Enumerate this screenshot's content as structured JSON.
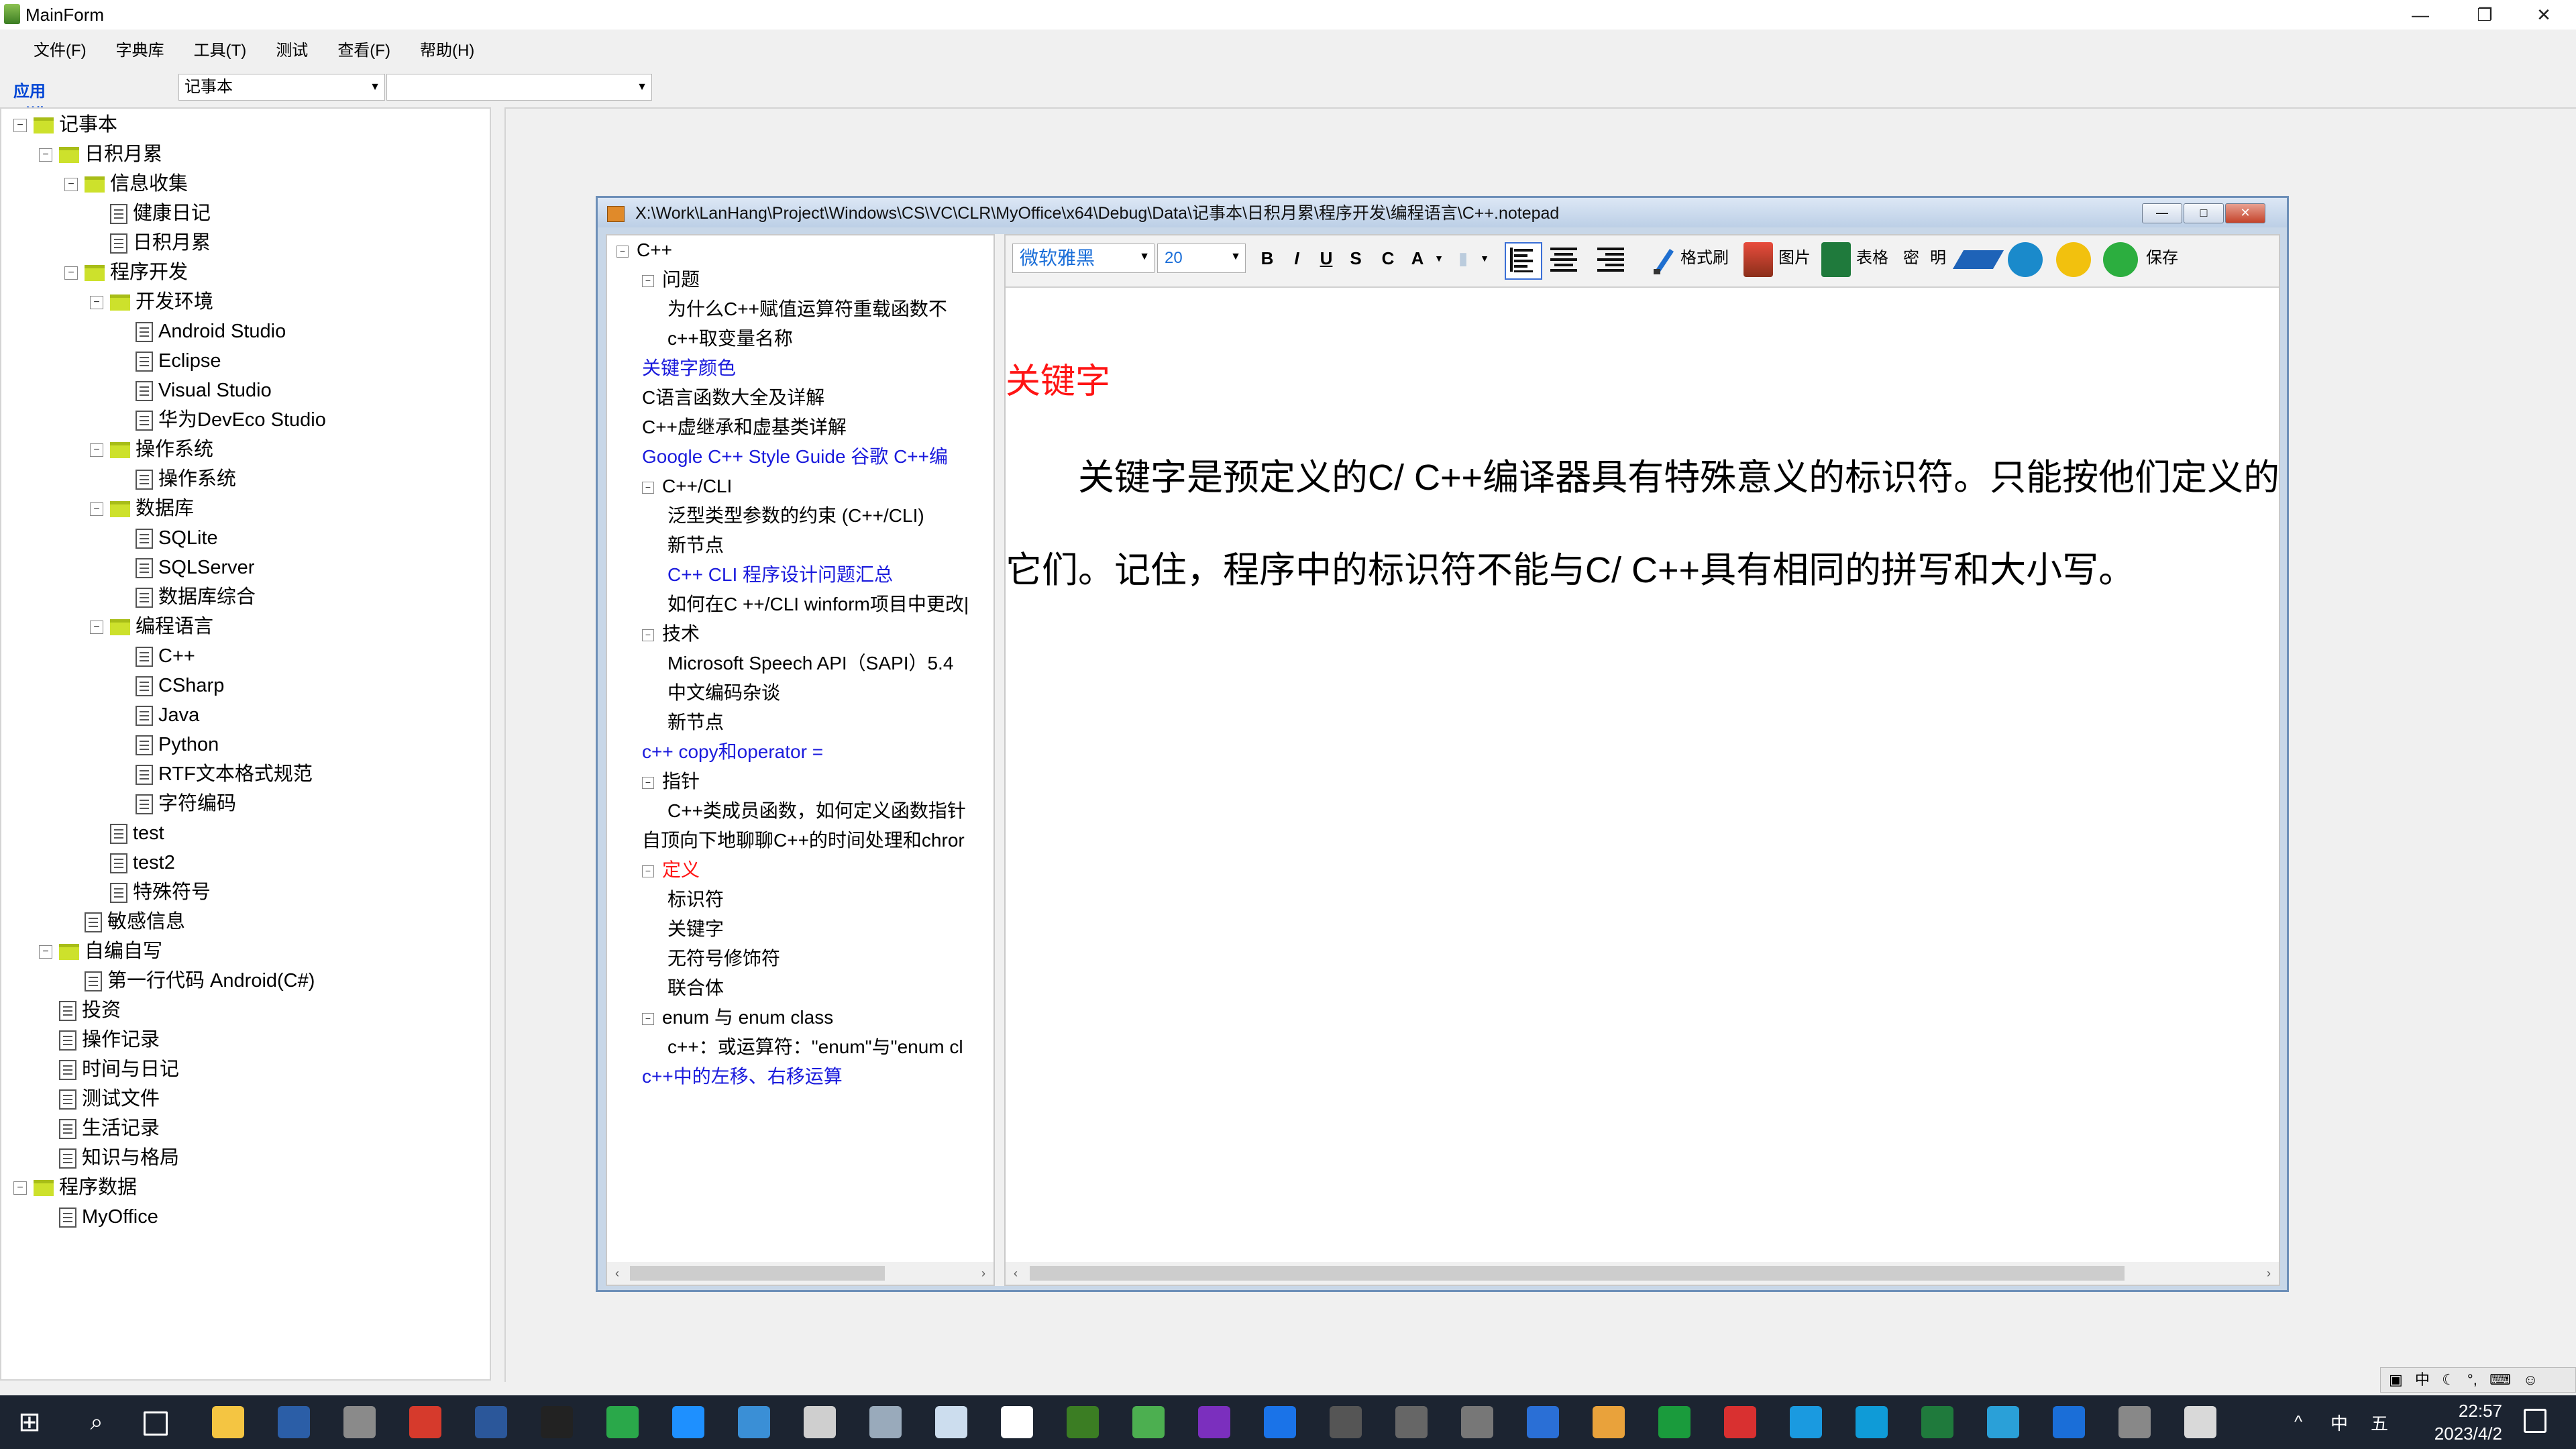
{
  "window": {
    "title": "MainForm",
    "minimize": "—",
    "restore": "❐",
    "close": "✕"
  },
  "menu": [
    {
      "label": "文件(F)"
    },
    {
      "label": "字典库"
    },
    {
      "label": "工具(T)"
    },
    {
      "label": "测试"
    },
    {
      "label": "查看(F)"
    },
    {
      "label": "帮助(H)"
    }
  ],
  "module_bar": {
    "label": "应用（模块）类型:",
    "selected": "记事本",
    "second": ""
  },
  "tree": [
    {
      "label": "记事本",
      "icon": "folder",
      "exp": "−"
    },
    {
      "label": "日积月累",
      "icon": "folder",
      "exp": "−"
    },
    {
      "label": "信息收集",
      "icon": "folder",
      "exp": "−"
    },
    {
      "label": "健康日记",
      "icon": "doc"
    },
    {
      "label": "日积月累",
      "icon": "doc"
    },
    {
      "label": "程序开发",
      "icon": "folder",
      "exp": "−"
    },
    {
      "label": "开发环境",
      "icon": "folder",
      "exp": "−"
    },
    {
      "label": "Android Studio",
      "icon": "doc"
    },
    {
      "label": "Eclipse",
      "icon": "doc"
    },
    {
      "label": "Visual Studio",
      "icon": "doc"
    },
    {
      "label": "华为DevEco Studio",
      "icon": "doc"
    },
    {
      "label": "操作系统",
      "icon": "folder",
      "exp": "−"
    },
    {
      "label": "操作系统",
      "icon": "doc"
    },
    {
      "label": "数据库",
      "icon": "folder",
      "exp": "−"
    },
    {
      "label": "SQLite",
      "icon": "doc"
    },
    {
      "label": "SQLServer",
      "icon": "doc"
    },
    {
      "label": "数据库综合",
      "icon": "doc"
    },
    {
      "label": "编程语言",
      "icon": "folder",
      "exp": "−"
    },
    {
      "label": "C++",
      "icon": "doc"
    },
    {
      "label": "CSharp",
      "icon": "doc"
    },
    {
      "label": "Java",
      "icon": "doc"
    },
    {
      "label": "Python",
      "icon": "doc"
    },
    {
      "label": "RTF文本格式规范",
      "icon": "doc"
    },
    {
      "label": "字符编码",
      "icon": "doc"
    },
    {
      "label": "test",
      "icon": "doc"
    },
    {
      "label": "test2",
      "icon": "doc"
    },
    {
      "label": "特殊符号",
      "icon": "doc"
    },
    {
      "label": "敏感信息",
      "icon": "doc"
    },
    {
      "label": "自编自写",
      "icon": "folder",
      "exp": "−"
    },
    {
      "label": "第一行代码 Android(C#)",
      "icon": "doc"
    },
    {
      "label": "投资",
      "icon": "doc"
    },
    {
      "label": "操作记录",
      "icon": "doc"
    },
    {
      "label": "时间与日记",
      "icon": "doc"
    },
    {
      "label": "测试文件",
      "icon": "doc"
    },
    {
      "label": "生活记录",
      "icon": "doc"
    },
    {
      "label": "知识与格局",
      "icon": "doc"
    },
    {
      "label": "程序数据",
      "icon": "folder",
      "exp": "−"
    },
    {
      "label": "MyOffice",
      "icon": "doc"
    }
  ],
  "child": {
    "path": "X:\\Work\\LanHang\\Project\\Windows\\CS\\VC\\CLR\\MyOffice\\x64\\Debug\\Data\\记事本\\日积月累\\程序开发\\编程语言\\C++.notepad",
    "btn_min": "—",
    "btn_max": "□",
    "btn_close": "✕"
  },
  "inner_tree": [
    {
      "label": "C++",
      "exp": "−",
      "color": "#000000"
    },
    {
      "label": "问题",
      "exp": "−",
      "color": "#000000"
    },
    {
      "label": "为什么C++赋值运算符重载函数不",
      "color": "#000000"
    },
    {
      "label": "c++取变量名称",
      "color": "#000000"
    },
    {
      "label": "关键字颜色",
      "color": "#1a1adc"
    },
    {
      "label": "C语言函数大全及详解",
      "color": "#000000"
    },
    {
      "label": "C++虚继承和虚基类详解",
      "color": "#000000"
    },
    {
      "label": "Google C++ Style Guide 谷歌 C++编",
      "color": "#1a1adc"
    },
    {
      "label": "C++/CLI",
      "exp": "−",
      "color": "#000000"
    },
    {
      "label": "泛型类型参数的约束 (C++/CLI)",
      "color": "#000000"
    },
    {
      "label": "新节点",
      "color": "#000000"
    },
    {
      "label": "C++ CLI 程序设计问题汇总",
      "color": "#1a1adc"
    },
    {
      "label": "如何在C ++/CLI winform项目中更改|",
      "color": "#000000"
    },
    {
      "label": "技术",
      "exp": "−",
      "color": "#000000"
    },
    {
      "label": "Microsoft Speech API（SAPI）5.4",
      "color": "#000000"
    },
    {
      "label": "中文编码杂谈",
      "color": "#000000"
    },
    {
      "label": "新节点",
      "color": "#000000"
    },
    {
      "label": "c++ copy和operator =",
      "color": "#1a1adc"
    },
    {
      "label": "指针",
      "exp": "−",
      "color": "#000000"
    },
    {
      "label": "C++类成员函数，如何定义函数指针",
      "color": "#000000"
    },
    {
      "label": "自顶向下地聊聊C++的时间处理和chror",
      "color": "#000000"
    },
    {
      "label": "定义",
      "exp": "−",
      "color": "#ff1414"
    },
    {
      "label": "标识符",
      "color": "#000000"
    },
    {
      "label": "关键字",
      "color": "#000000"
    },
    {
      "label": "无符号修饰符",
      "color": "#000000"
    },
    {
      "label": "联合体",
      "color": "#000000"
    },
    {
      "label": "enum 与 enum class",
      "exp": "−",
      "color": "#000000"
    },
    {
      "label": "c++：或运算符：\"enum\"与\"enum cl",
      "color": "#000000"
    },
    {
      "label": "c++中的左移、右移运算",
      "color": "#1a1adc"
    }
  ],
  "toolbar": {
    "font": "微软雅黑",
    "size": "20",
    "bold": "B",
    "italic": "I",
    "underline": "U",
    "strike": "S",
    "c_btn": "C",
    "a_btn": "A",
    "format_brush": "格式刷",
    "image": "图片",
    "table": "表格",
    "secret": "密",
    "clear": "明",
    "save": "保存"
  },
  "document": {
    "heading": "关键字",
    "line1": "　　关键字是预定义的C/ C++编译器具有特殊意义的标识符。只能按他们定义的",
    "line2": "它们。记住，程序中的标识符不能与C/ C++具有相同的拼写和大小写。"
  },
  "taskbar": {
    "time": "22:57",
    "date": "2023/4/2",
    "ime": "中",
    "ime2": "五"
  },
  "colors": {
    "accent": "#0046d5",
    "link": "#1a1adc",
    "heading": "#ff1414"
  }
}
